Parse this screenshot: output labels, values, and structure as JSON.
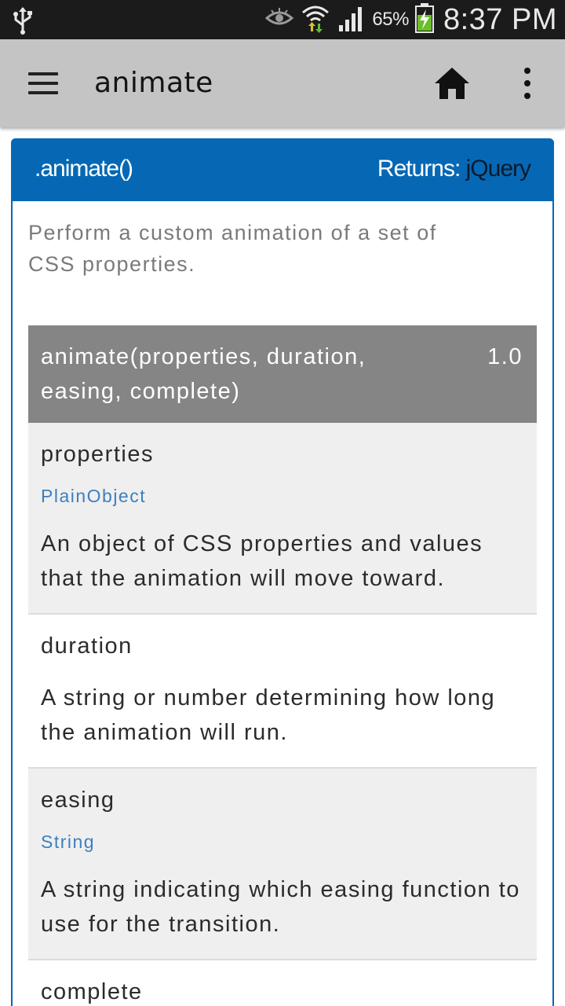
{
  "status_bar": {
    "battery_percent": "65%",
    "time": "8:37 PM",
    "icons": [
      "usb-icon",
      "eye-icon",
      "wifi-icon",
      "signal-icon",
      "battery-charging-icon"
    ]
  },
  "app_bar": {
    "title": "animate",
    "icons": [
      "menu-icon",
      "home-icon",
      "more-vert-icon"
    ]
  },
  "card": {
    "method": ".animate()",
    "returns_label": "Returns: ",
    "returns_type": "jQuery",
    "description": "Perform a custom animation of a set of CSS properties.",
    "signature": {
      "text": "animate(properties, duration, easing, complete)",
      "version": "1.0"
    },
    "params": [
      {
        "name": "properties",
        "type": "PlainObject",
        "description": "An object of CSS properties and values that the animation will move toward."
      },
      {
        "name": "duration",
        "type": "",
        "description": "A string or number determining how long the animation will run."
      },
      {
        "name": "easing",
        "type": "String",
        "description": "A string indicating which easing function to use for the transition."
      },
      {
        "name": "complete",
        "type": "",
        "description": ""
      }
    ]
  },
  "colors": {
    "status_bar": "#1b1b1b",
    "app_bar": "#c4c4c4",
    "card_header": "#0668b4",
    "signature_bg": "#858585",
    "type_link": "#3d7fbf"
  }
}
